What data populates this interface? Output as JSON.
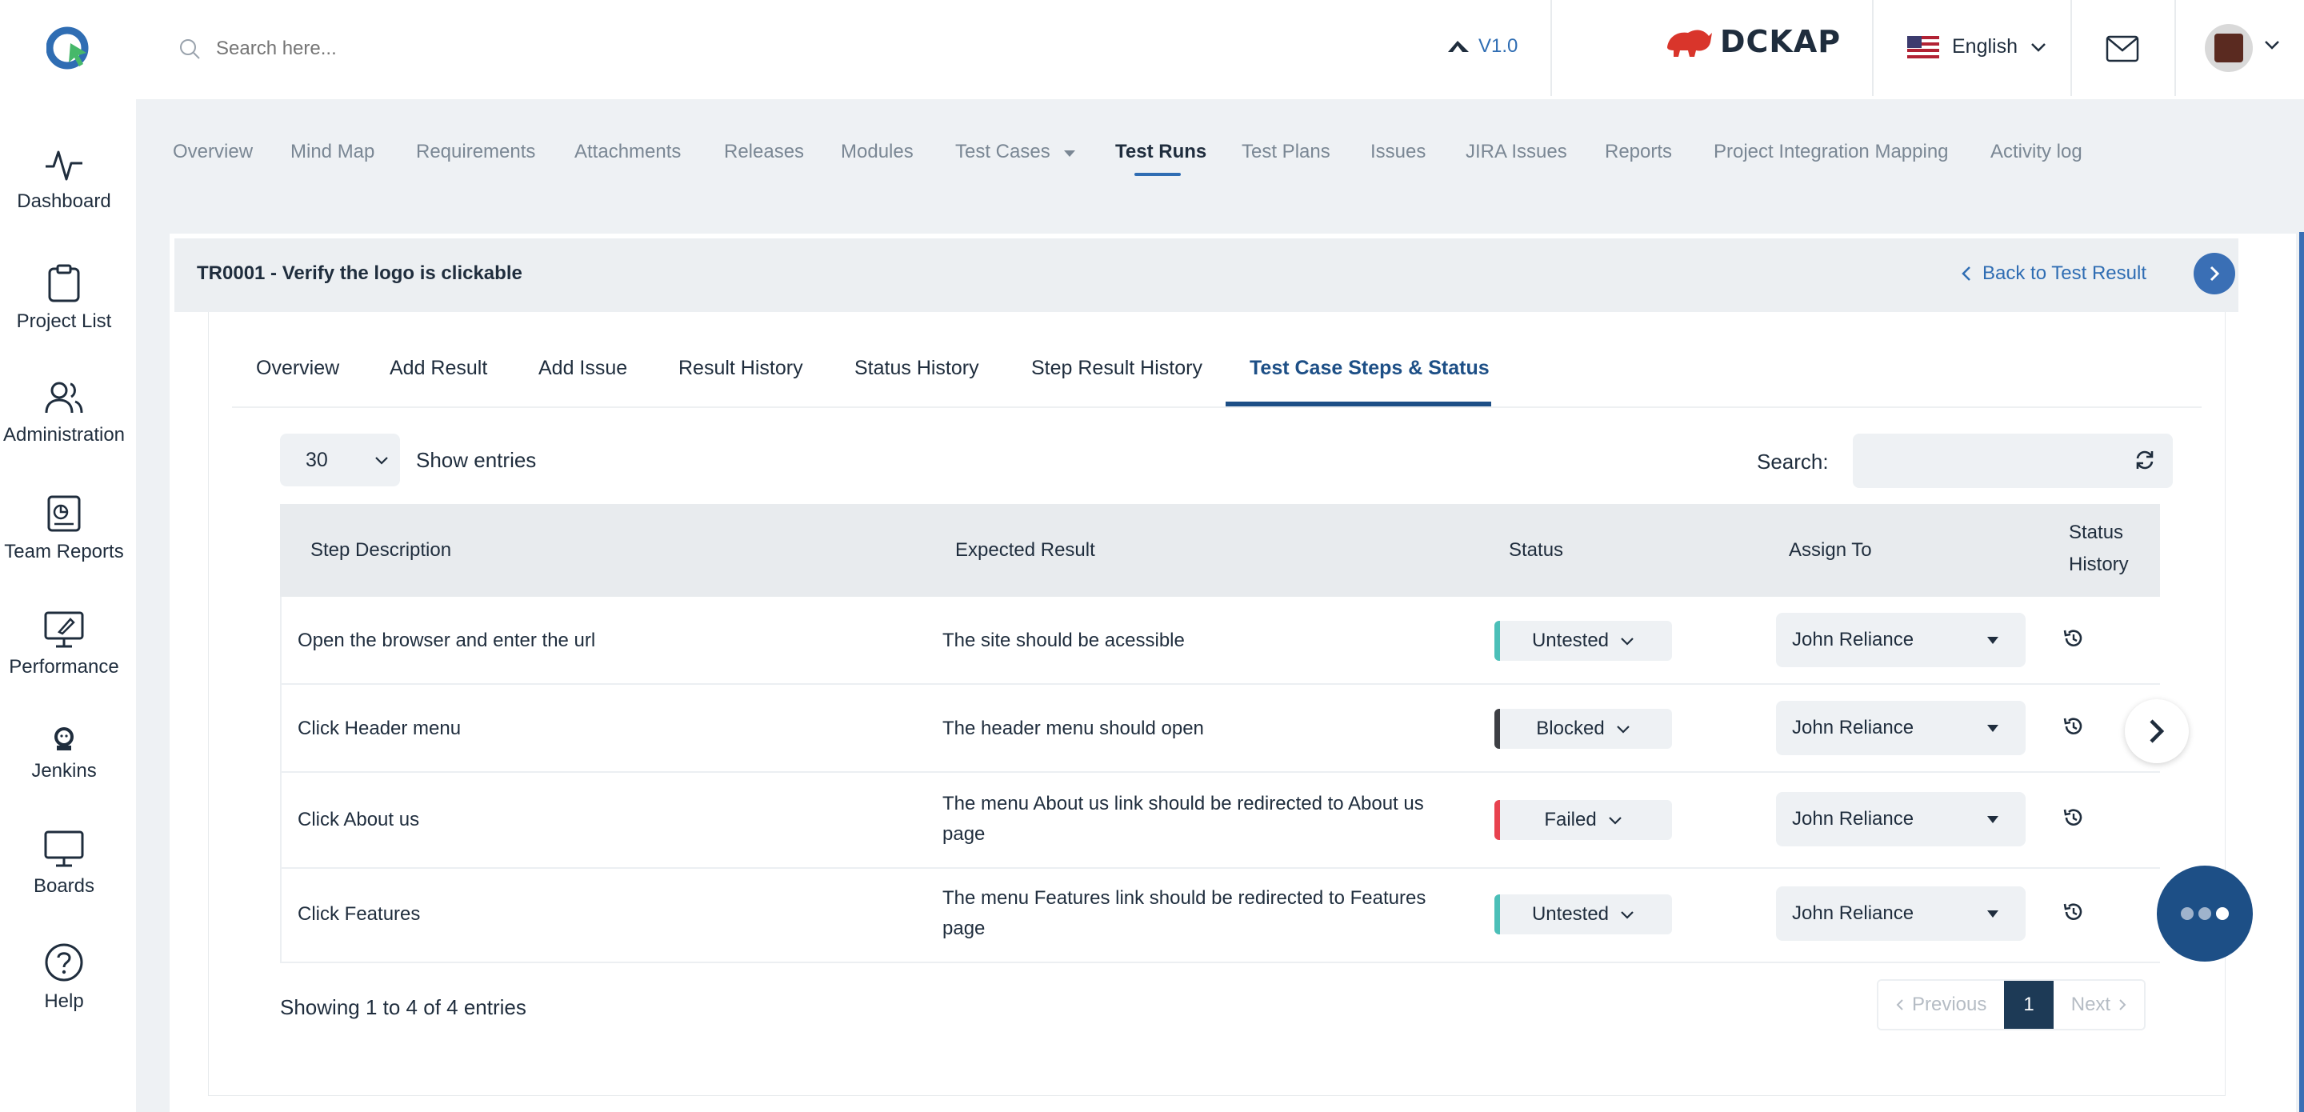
{
  "header": {
    "search_placeholder": "Search here...",
    "version": "V1.0",
    "brand": "DCKAP",
    "language": "English"
  },
  "sidebar": {
    "items": [
      {
        "label": "Dashboard",
        "icon": "pulse-icon"
      },
      {
        "label": "Project List",
        "icon": "clipboard-icon"
      },
      {
        "label": "Administration",
        "icon": "users-icon"
      },
      {
        "label": "Team Reports",
        "icon": "report-icon"
      },
      {
        "label": "Performance",
        "icon": "rocket-board-icon"
      },
      {
        "label": "Jenkins",
        "icon": "jenkins-icon"
      },
      {
        "label": "Boards",
        "icon": "board-icon"
      },
      {
        "label": "Help",
        "icon": "help-icon"
      }
    ]
  },
  "project_nav": {
    "items": [
      "Overview",
      "Mind Map",
      "Requirements",
      "Attachments",
      "Releases",
      "Modules",
      "Test Cases",
      "Test Runs",
      "Test Plans",
      "Issues",
      "JIRA Issues",
      "Reports",
      "Project Integration Mapping",
      "Activity log"
    ],
    "active": "Test Runs"
  },
  "panel": {
    "title": "TR0001 - Verify the logo is clickable",
    "back_label": "Back to Test Result"
  },
  "tabs": {
    "items": [
      "Overview",
      "Add Result",
      "Add Issue",
      "Result History",
      "Status History",
      "Step Result History",
      "Test Case Steps & Status"
    ],
    "active": "Test Case Steps & Status"
  },
  "table_controls": {
    "entries_value": "30",
    "entries_label": "Show entries",
    "search_label": "Search:",
    "search_value": ""
  },
  "table": {
    "headers": {
      "step": "Step Description",
      "expected": "Expected Result",
      "status": "Status",
      "assign": "Assign To",
      "history_1": "Status",
      "history_2": "History"
    },
    "rows": [
      {
        "step": "Open the browser and enter the url",
        "expected": "The site should be acessible",
        "expected_2": "",
        "status": "Untested",
        "status_color": "#4bbfb8",
        "assign": "John Reliance"
      },
      {
        "step": "Click Header menu",
        "expected": "The header menu should open",
        "expected_2": "",
        "status": "Blocked",
        "status_color": "#3d3f44",
        "assign": "John Reliance"
      },
      {
        "step": "Click About us",
        "expected": "The menu About us link should be redirected to About us",
        "expected_2": "page",
        "status": "Failed",
        "status_color": "#e8424f",
        "assign": "John Reliance"
      },
      {
        "step": "Click Features",
        "expected": "The menu Features link should be redirected to Features",
        "expected_2": "page",
        "status": "Untested",
        "status_color": "#4bbfb8",
        "assign": "John Reliance"
      }
    ]
  },
  "footer": {
    "showing": "Showing 1 to 4 of 4 entries",
    "previous": "Previous",
    "current_page": "1",
    "next": "Next"
  },
  "colors": {
    "accent": "#2f6db3",
    "dark_accent": "#1d4f86",
    "page_bg": "#eef1f4"
  }
}
